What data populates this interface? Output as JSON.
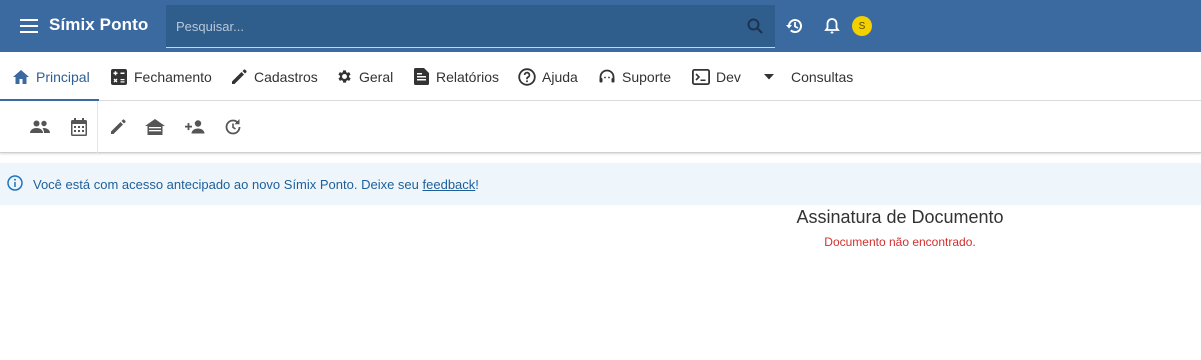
{
  "appbar": {
    "title": "Símix Ponto",
    "search_placeholder": "Pesquisar...",
    "avatar_initial": "S",
    "color": "#3a6aa0"
  },
  "tabs": [
    {
      "label": "Principal",
      "icon": "home-icon",
      "active": true
    },
    {
      "label": "Fechamento",
      "icon": "calculator-icon"
    },
    {
      "label": "Cadastros",
      "icon": "pencil-icon"
    },
    {
      "label": "Geral",
      "icon": "gear-icon"
    },
    {
      "label": "Relatórios",
      "icon": "document-icon"
    },
    {
      "label": "Ajuda",
      "icon": "help-circle-icon"
    },
    {
      "label": "Suporte",
      "icon": "headset-icon"
    },
    {
      "label": "Dev",
      "icon": "terminal-icon"
    },
    {
      "label": "Consultas",
      "icon": "caret-down-icon"
    }
  ],
  "toolbar": {
    "icons": [
      "people-icon",
      "calendar-icon",
      "edit-icon",
      "house-icon",
      "person-add-icon",
      "history-icon"
    ]
  },
  "banner": {
    "text_before": "Você está com acesso antecipado ao novo Símix Ponto. Deixe seu ",
    "link_text": "feedback",
    "text_after": "!",
    "color": "#1f5f99"
  },
  "content": {
    "title": "Assinatura de Documento",
    "error": "Documento não encontrado.",
    "error_color": "#d32f2f"
  }
}
